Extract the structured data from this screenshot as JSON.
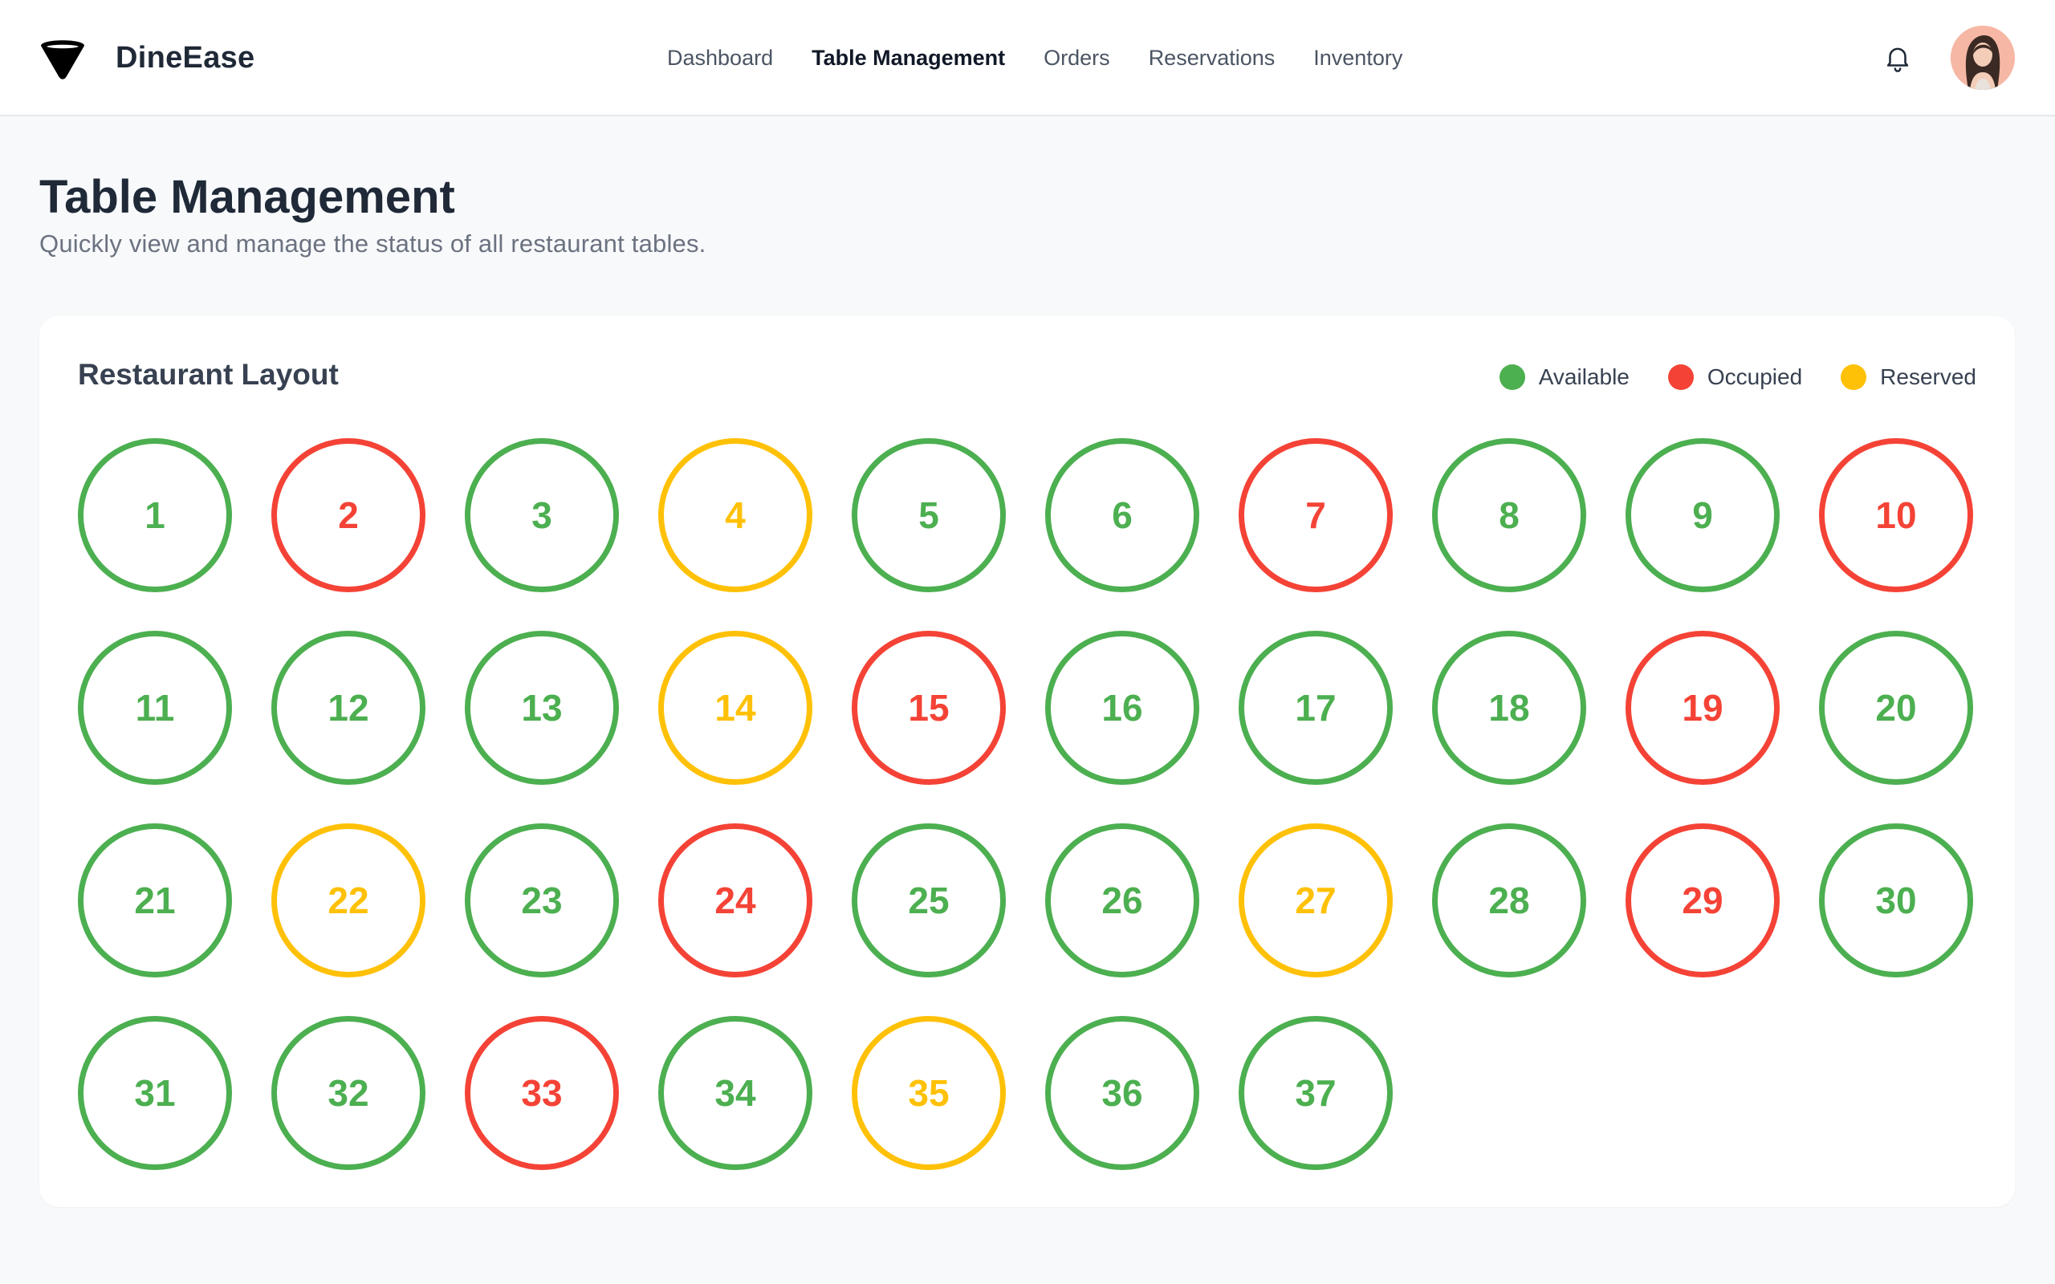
{
  "app": {
    "name": "DineEase"
  },
  "nav": {
    "items": [
      {
        "label": "Dashboard",
        "active": false
      },
      {
        "label": "Table Management",
        "active": true
      },
      {
        "label": "Orders",
        "active": false
      },
      {
        "label": "Reservations",
        "active": false
      },
      {
        "label": "Inventory",
        "active": false
      }
    ],
    "icons": {
      "notifications": "bell-icon",
      "user": "avatar"
    }
  },
  "page": {
    "title": "Table Management",
    "subtitle": "Quickly view and manage the status of all restaurant tables."
  },
  "layout": {
    "title": "Restaurant Layout",
    "legend": [
      {
        "status": "available",
        "label": "Available",
        "color": "#4caf50"
      },
      {
        "status": "occupied",
        "label": "Occupied",
        "color": "#f44336"
      },
      {
        "status": "reserved",
        "label": "Reserved",
        "color": "#ffc107"
      }
    ],
    "tables": [
      {
        "number": "1",
        "status": "available"
      },
      {
        "number": "2",
        "status": "occupied"
      },
      {
        "number": "3",
        "status": "available"
      },
      {
        "number": "4",
        "status": "reserved"
      },
      {
        "number": "5",
        "status": "available"
      },
      {
        "number": "6",
        "status": "available"
      },
      {
        "number": "7",
        "status": "occupied"
      },
      {
        "number": "8",
        "status": "available"
      },
      {
        "number": "9",
        "status": "available"
      },
      {
        "number": "10",
        "status": "occupied"
      },
      {
        "number": "11",
        "status": "available"
      },
      {
        "number": "12",
        "status": "available"
      },
      {
        "number": "13",
        "status": "available"
      },
      {
        "number": "14",
        "status": "reserved"
      },
      {
        "number": "15",
        "status": "occupied"
      },
      {
        "number": "16",
        "status": "available"
      },
      {
        "number": "17",
        "status": "available"
      },
      {
        "number": "18",
        "status": "available"
      },
      {
        "number": "19",
        "status": "occupied"
      },
      {
        "number": "20",
        "status": "available"
      },
      {
        "number": "21",
        "status": "available"
      },
      {
        "number": "22",
        "status": "reserved"
      },
      {
        "number": "23",
        "status": "available"
      },
      {
        "number": "24",
        "status": "occupied"
      },
      {
        "number": "25",
        "status": "available"
      },
      {
        "number": "26",
        "status": "available"
      },
      {
        "number": "27",
        "status": "reserved"
      },
      {
        "number": "28",
        "status": "available"
      },
      {
        "number": "29",
        "status": "occupied"
      },
      {
        "number": "30",
        "status": "available"
      },
      {
        "number": "31",
        "status": "available"
      },
      {
        "number": "32",
        "status": "available"
      },
      {
        "number": "33",
        "status": "occupied"
      },
      {
        "number": "34",
        "status": "available"
      },
      {
        "number": "35",
        "status": "reserved"
      },
      {
        "number": "36",
        "status": "available"
      },
      {
        "number": "37",
        "status": "available"
      }
    ]
  }
}
